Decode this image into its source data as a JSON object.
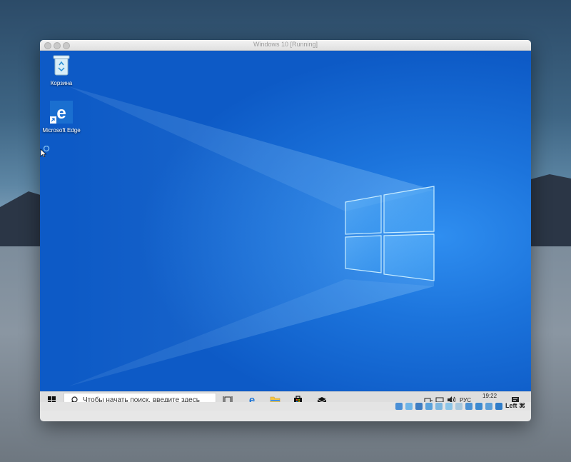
{
  "vm_window": {
    "title": "Windows 10 [Running]"
  },
  "desktop": {
    "icons": [
      {
        "name": "recycle-bin-icon",
        "label": "Корзина"
      },
      {
        "name": "edge-icon",
        "label": "Microsoft Edge"
      }
    ]
  },
  "taskbar": {
    "search_placeholder": "Чтобы начать поиск, введите здесь",
    "pinned": [
      "task-view-icon",
      "edge-icon",
      "file-explorer-icon",
      "store-icon",
      "mail-icon"
    ],
    "tray": {
      "language": "РУС",
      "time": "19:22"
    }
  },
  "statusbar": {
    "host_key": "Left ⌘"
  },
  "colors": {
    "desktop_blue": "#1c74dc",
    "taskbar": "#dedede"
  }
}
